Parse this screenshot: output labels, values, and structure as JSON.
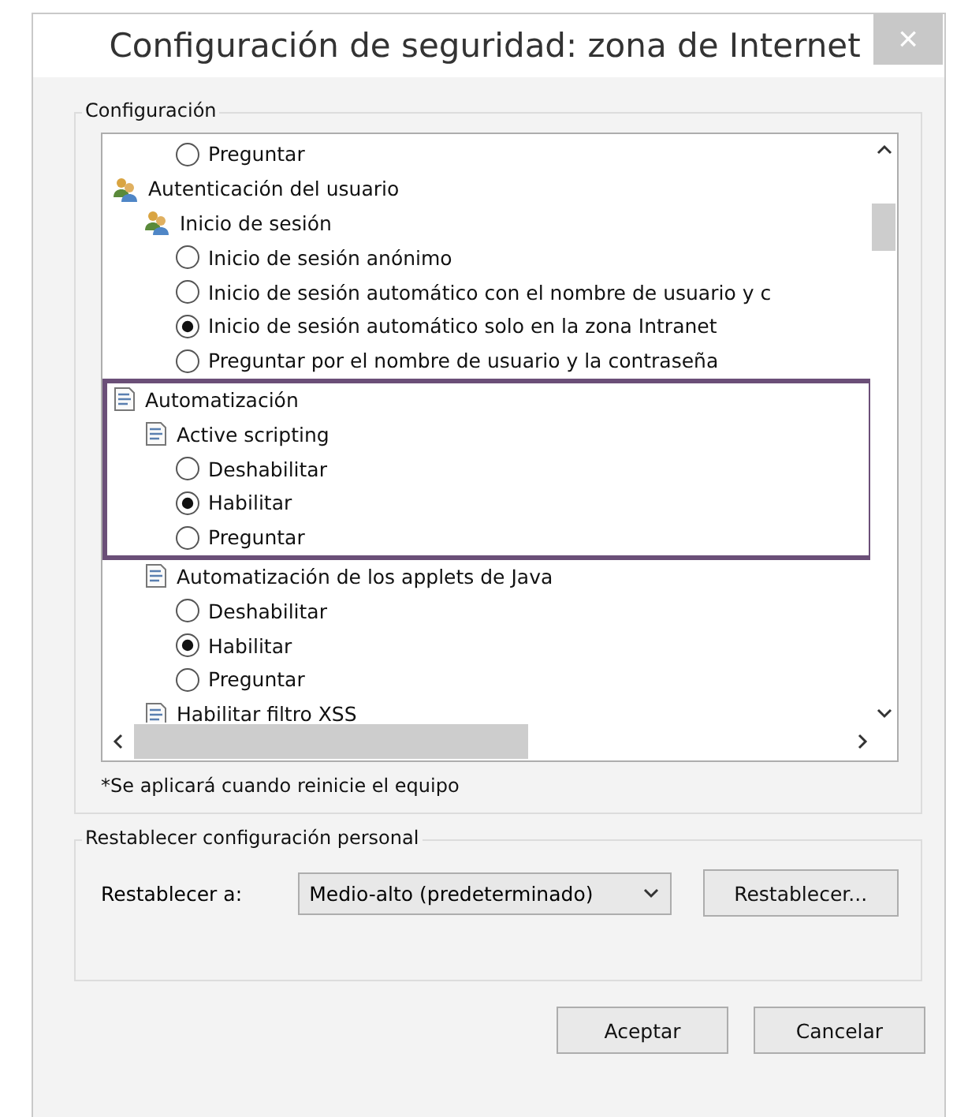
{
  "window": {
    "title": "Configuración de seguridad: zona de Internet",
    "close": "×"
  },
  "settings_group": {
    "label": "Configuración",
    "tree": [
      {
        "kind": "radio",
        "label": "Preguntar",
        "selected": false
      },
      {
        "kind": "users",
        "label": "Autenticación del usuario",
        "children": [
          {
            "kind": "users",
            "label": "Inicio de sesión",
            "children": [
              {
                "kind": "radio",
                "label": "Inicio de sesión anónimo",
                "selected": false
              },
              {
                "kind": "radio",
                "label": "Inicio de sesión automático con el nombre de usuario y c",
                "selected": false
              },
              {
                "kind": "radio",
                "label": "Inicio de sesión automático solo en la zona Intranet",
                "selected": true
              },
              {
                "kind": "radio",
                "label": "Preguntar por el nombre de usuario y la contraseña",
                "selected": false
              }
            ]
          }
        ]
      },
      {
        "kind": "script",
        "label": "Automatización",
        "highlighted": true,
        "children": [
          {
            "kind": "script",
            "label": "Active scripting",
            "highlighted": true,
            "children": [
              {
                "kind": "radio",
                "label": "Deshabilitar",
                "selected": false
              },
              {
                "kind": "radio",
                "label": "Habilitar",
                "selected": true
              },
              {
                "kind": "radio",
                "label": "Preguntar",
                "selected": false
              }
            ]
          },
          {
            "kind": "script",
            "label": "Automatización de los applets de Java",
            "children": [
              {
                "kind": "radio",
                "label": "Deshabilitar",
                "selected": false
              },
              {
                "kind": "radio",
                "label": "Habilitar",
                "selected": true
              },
              {
                "kind": "radio",
                "label": "Preguntar",
                "selected": false
              }
            ]
          },
          {
            "kind": "script",
            "label": "Habilitar filtro XSS"
          }
        ]
      }
    ],
    "note": "*Se aplicará cuando reinicie el equipo"
  },
  "reset_group": {
    "label": "Restablecer configuración personal",
    "field_label": "Restablecer a:",
    "dropdown_value": "Medio-alto (predeterminado)",
    "button": "Restablecer..."
  },
  "buttons": [
    "Aceptar",
    "Cancelar"
  ]
}
